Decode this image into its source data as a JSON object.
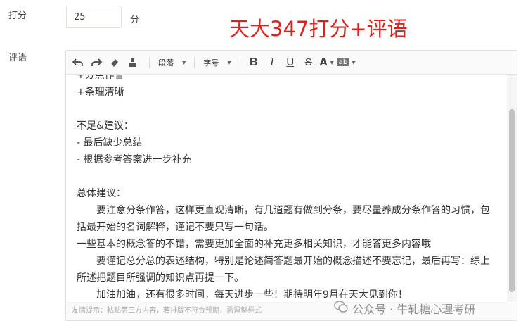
{
  "form": {
    "score_label": "打分",
    "score_value": "25",
    "score_unit": "分",
    "comment_label": "评语"
  },
  "overlay_title": "天大347打分+评语",
  "toolbar": {
    "paragraph_select": "段落",
    "fontsize_select": "字号",
    "bold": "B",
    "italic": "I",
    "underline": "U",
    "strike": "S",
    "font_color": "A",
    "bg_color": "ab"
  },
  "editor": {
    "lines": [
      "+分点作答",
      "+条理清晰",
      "",
      "不足&建议：",
      "- 最后缺少总结",
      "- 根据参考答案进一步补充",
      "",
      "总体建议：",
      "要注意分条作答，这样更直观清晰，有几道题有做到分条，要尽量养成分条作答的习惯，包括最开始的名词解释，谨记不要只写一句话。",
      "一些基本的概念答的不错，需要更加全面的补充更多相关知识，才能答更多内容哦",
      "要谨记总分总的表述结构，特别是论述简答题最开始的概念描述不要忘记，最后再写：综上所述把题目所强调的知识点再提一下。",
      "加油加油，还有很多时间，每天进步一些！期待明年9月在天大见到你！"
    ],
    "hint": "友情提示：粘贴第三方内容，若排版不符合预期，需调整样式"
  },
  "watermark": "公众号 · 牛轧糖心理考研",
  "colors": {
    "overlay_red": "#e0201a",
    "border": "#dcdfe6"
  }
}
